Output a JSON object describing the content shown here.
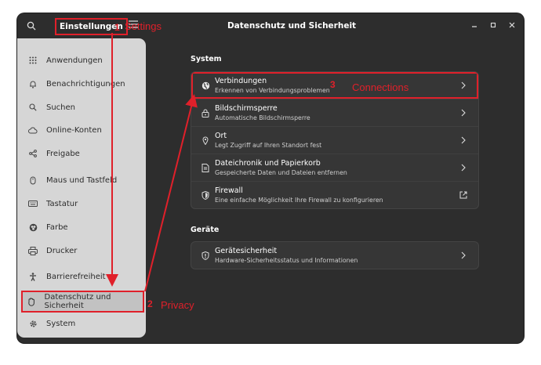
{
  "window": {
    "app_title": "Einstellungen",
    "page_title": "Datenschutz und Sicherheit",
    "controls": [
      "minimize",
      "maximize",
      "close"
    ]
  },
  "sidebar": {
    "items": [
      {
        "label": "Anwendungen",
        "icon": "apps-icon"
      },
      {
        "label": "Benachrichtigungen",
        "icon": "bell-icon"
      },
      {
        "label": "Suchen",
        "icon": "search-icon"
      },
      {
        "label": "Online-Konten",
        "icon": "cloud-icon"
      },
      {
        "label": "Freigabe",
        "icon": "share-icon"
      },
      {
        "label": "Maus und Tastfeld",
        "icon": "mouse-icon"
      },
      {
        "label": "Tastatur",
        "icon": "keyboard-icon"
      },
      {
        "label": "Farbe",
        "icon": "color-icon"
      },
      {
        "label": "Drucker",
        "icon": "printer-icon"
      },
      {
        "label": "Barrierefreiheit",
        "icon": "accessibility-icon"
      },
      {
        "label": "Datenschutz und Sicherheit",
        "icon": "privacy-hand-icon",
        "active": true
      },
      {
        "label": "System",
        "icon": "system-gear-icon"
      }
    ]
  },
  "main": {
    "system_section": {
      "title": "System",
      "rows": [
        {
          "title": "Verbindungen",
          "subtitle": "Erkennen von Verbindungsproblemen",
          "icon": "globe-icon",
          "action": "chevron-right"
        },
        {
          "title": "Bildschirmsperre",
          "subtitle": "Automatische Bildschirmsperre",
          "icon": "lock-icon",
          "action": "chevron-right"
        },
        {
          "title": "Ort",
          "subtitle": "Legt Zugriff auf Ihren Standort fest",
          "icon": "location-pin-icon",
          "action": "chevron-right"
        },
        {
          "title": "Dateichronik und Papierkorb",
          "subtitle": "Gespeicherte Daten und Dateien entfernen",
          "icon": "file-history-icon",
          "action": "chevron-right"
        },
        {
          "title": "Firewall",
          "subtitle": "Eine einfache Möglichkeit Ihre Firewall zu konfigurieren",
          "icon": "shield-icon",
          "action": "external-link"
        }
      ]
    },
    "devices_section": {
      "title": "Geräte",
      "rows": [
        {
          "title": "Gerätesicherheit",
          "subtitle": "Hardware-Sicherheitsstatus und Informationen",
          "icon": "device-shield-icon",
          "action": "chevron-right"
        }
      ]
    }
  },
  "annotations": {
    "step1": {
      "num": "1",
      "text": "Settings"
    },
    "step2": {
      "num": "2",
      "text": "Privacy"
    },
    "step3": {
      "num": "3",
      "text": "Connections"
    },
    "color": "#e0202a"
  }
}
